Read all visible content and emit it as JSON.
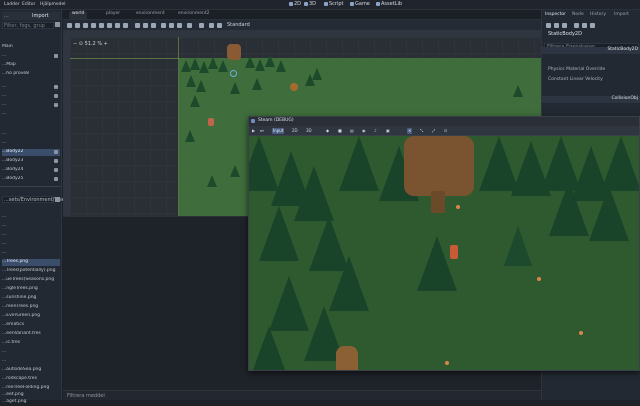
{
  "menu": {
    "items": [
      "Ladder",
      "Editor",
      "Hjälpmedel"
    ]
  },
  "workspaces": [
    {
      "label": "2D",
      "icon": "2d-icon"
    },
    {
      "label": "3D",
      "icon": "3d-icon"
    },
    {
      "label": "Script",
      "icon": "script-icon"
    },
    {
      "label": "Game",
      "icon": "game-icon"
    },
    {
      "label": "AssetLib",
      "icon": "assetlib-icon"
    }
  ],
  "left_dock": {
    "tabs": [
      "...",
      "Import"
    ],
    "search_placeholder": "Filter, fogs, grup",
    "scene_items": [
      {
        "label": "Main",
        "selected": false
      },
      {
        "label": "...",
        "selected": false
      },
      {
        "label": "...Map",
        "selected": false
      },
      {
        "label": "...ho prove8",
        "selected": false
      },
      {
        "label": "...",
        "selected": false
      },
      {
        "label": "...",
        "selected": false
      },
      {
        "label": "...",
        "selected": false
      },
      {
        "label": "...",
        "selected": false
      },
      {
        "label": "...",
        "selected": false
      },
      {
        "label": "...",
        "selected": false
      },
      {
        "label": "...Body22",
        "selected": true
      },
      {
        "label": "...Body23",
        "selected": false
      },
      {
        "label": "...Body24",
        "selected": false
      },
      {
        "label": "...Body25",
        "selected": false
      }
    ],
    "files_path": "...sets/Environment/Trees/T",
    "file_items": [
      "...",
      "...",
      "...",
      "...",
      "...",
      "...Trees.png",
      "...Trees(potentially).png",
      "...ueTrees(Seasons.png",
      "...ngleTrees.png",
      "...sunshine.png",
      "...reenTrees.png",
      "...EverGreen.png",
      "...ematics",
      "...eenVariant.tres",
      "...ic.tres",
      "...",
      "...",
      "...outsideSea.png",
      "...rodscape.tres",
      "...reeTreeFolding.png",
      "...eet.png",
      "...aget.png"
    ]
  },
  "editor_tabs": [
    {
      "label": "world",
      "active": true
    },
    {
      "label": "player",
      "active": false
    },
    {
      "label": "environment",
      "active": false
    },
    {
      "label": "environment2",
      "active": false
    }
  ],
  "viewport": {
    "zoom": "51.2 %",
    "snap_label": "Standard"
  },
  "bottom_panel": {
    "status_text": "Filtrera meddel"
  },
  "right_dock": {
    "tabs": [
      {
        "label": "Inspector",
        "active": true
      },
      {
        "label": "Node",
        "active": false
      },
      {
        "label": "History",
        "active": false
      },
      {
        "label": "Import",
        "active": false
      }
    ],
    "node_name": "StaticBody2D",
    "filter_placeholder": "Filtrera Egenskaper",
    "sections": [
      {
        "label": "StaticBody2D"
      },
      {
        "label": "CollisionObj"
      }
    ],
    "properties": [
      "Physics Material Override",
      "Constant Linear Velocity",
      "Constant Angular Velocity"
    ]
  },
  "game_window": {
    "title": "Steam (DEBUG)",
    "toolbar": [
      {
        "label": "Input",
        "on": false
      },
      {
        "label": "2D",
        "on": false
      },
      {
        "label": "3D",
        "on": false
      }
    ]
  },
  "colors": {
    "accent": "#4a5e80",
    "grass": "#2f5a2f",
    "tree": "#1d4a2c",
    "trunk": "#6b4a2a"
  }
}
